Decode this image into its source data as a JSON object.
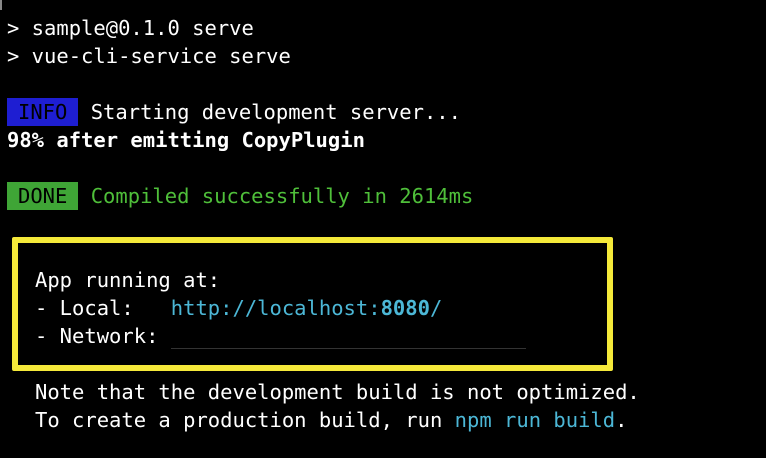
{
  "terminal": {
    "cmd1": "> sample@0.1.0 serve",
    "cmd2": "> vue-cli-service serve",
    "info_badge": "INFO",
    "info_text": " Starting development server...",
    "progress": "98% after emitting CopyPlugin",
    "done_badge": "DONE",
    "done_text": " Compiled successfully in 2614ms",
    "app_running": "App running at:",
    "local_label": "- Local:   ",
    "local_url_prefix": "http://localhost:",
    "local_url_port": "8080",
    "local_url_suffix": "/",
    "network_label": "- Network: ",
    "note_line1": "Note that the development build is not optimized.",
    "note_line2_prefix": "To create a production build, run ",
    "note_line2_cmd": "npm run build",
    "note_line2_suffix": "."
  },
  "colors": {
    "background": "#000000",
    "info_badge_bg": "#1e1ed2",
    "done_badge_bg": "#3fa536",
    "success_text": "#4fbf3a",
    "link_text": "#4cb7d6",
    "highlight_border": "#f5e93a"
  }
}
